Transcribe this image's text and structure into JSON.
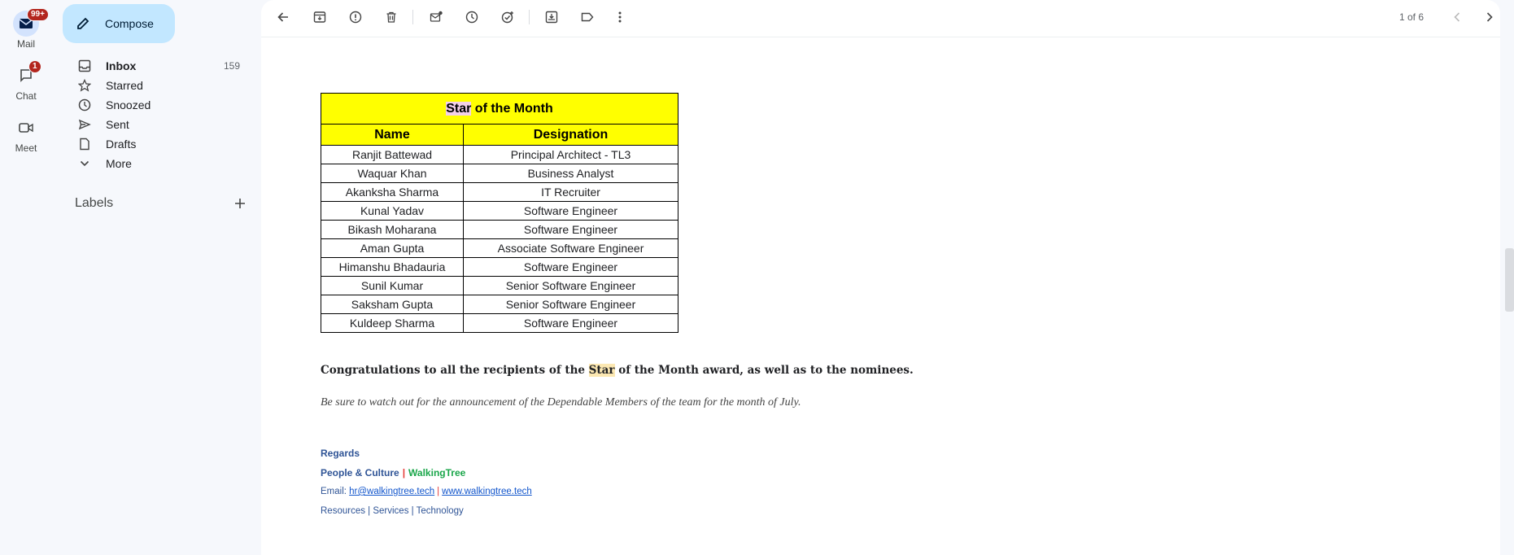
{
  "rail": {
    "mail": {
      "label": "Mail",
      "badge": "99+"
    },
    "chat": {
      "label": "Chat",
      "badge": "1"
    },
    "meet": {
      "label": "Meet"
    }
  },
  "nav": {
    "compose_label": "Compose",
    "items": [
      {
        "label": "Inbox",
        "count": "159",
        "icon": "inbox-icon"
      },
      {
        "label": "Starred",
        "icon": "star-icon"
      },
      {
        "label": "Snoozed",
        "icon": "clock-icon"
      },
      {
        "label": "Sent",
        "icon": "send-icon"
      },
      {
        "label": "Drafts",
        "icon": "draft-icon"
      },
      {
        "label": "More",
        "icon": "chevron-down-icon"
      }
    ],
    "labels_heading": "Labels"
  },
  "toolbar": {
    "pager": "1 of 6"
  },
  "email": {
    "table": {
      "title_highlight": "Star",
      "title_rest": " of the Month",
      "headers": [
        "Name",
        "Designation"
      ],
      "rows": [
        [
          "Ranjit Battewad",
          "Principal Architect - TL3"
        ],
        [
          "Waquar Khan",
          "Business Analyst"
        ],
        [
          "Akanksha Sharma",
          "IT Recruiter"
        ],
        [
          "Kunal Yadav",
          "Software Engineer"
        ],
        [
          "Bikash Moharana",
          "Software Engineer"
        ],
        [
          "Aman Gupta",
          "Associate Software Engineer"
        ],
        [
          "Himanshu Bhadauria",
          "Software Engineer"
        ],
        [
          "Sunil Kumar",
          "Senior Software Engineer"
        ],
        [
          "Saksham Gupta",
          "Senior Software Engineer"
        ],
        [
          "Kuldeep Sharma",
          "Software Engineer"
        ]
      ]
    },
    "congrats_pre": "Congratulations to all the recipients of the ",
    "congrats_star": "Star",
    "congrats_post": " of the Month award, as well as to the nominees.",
    "note": "Be sure to watch out for the announcement of the Dependable Members of the team for the month of July.",
    "signature": {
      "regards": "Regards",
      "team": "People & Culture",
      "sep": "|",
      "brand": "WalkingTree",
      "email_label": "Email: ",
      "email": "hr@walkingtree.tech",
      "website": "www.walkingtree.tech",
      "links": "Resources | Services | Technology"
    }
  }
}
